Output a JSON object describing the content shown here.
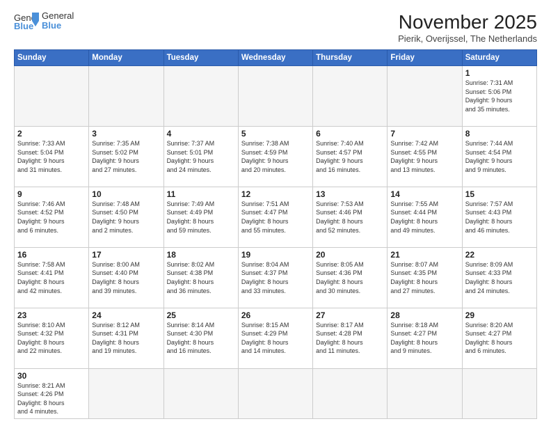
{
  "header": {
    "logo_general": "General",
    "logo_blue": "Blue",
    "title": "November 2025",
    "subtitle": "Pierik, Overijssel, The Netherlands"
  },
  "weekdays": [
    "Sunday",
    "Monday",
    "Tuesday",
    "Wednesday",
    "Thursday",
    "Friday",
    "Saturday"
  ],
  "weeks": [
    [
      {
        "day": "",
        "info": ""
      },
      {
        "day": "",
        "info": ""
      },
      {
        "day": "",
        "info": ""
      },
      {
        "day": "",
        "info": ""
      },
      {
        "day": "",
        "info": ""
      },
      {
        "day": "",
        "info": ""
      },
      {
        "day": "1",
        "info": "Sunrise: 7:31 AM\nSunset: 5:06 PM\nDaylight: 9 hours\nand 35 minutes."
      }
    ],
    [
      {
        "day": "2",
        "info": "Sunrise: 7:33 AM\nSunset: 5:04 PM\nDaylight: 9 hours\nand 31 minutes."
      },
      {
        "day": "3",
        "info": "Sunrise: 7:35 AM\nSunset: 5:02 PM\nDaylight: 9 hours\nand 27 minutes."
      },
      {
        "day": "4",
        "info": "Sunrise: 7:37 AM\nSunset: 5:01 PM\nDaylight: 9 hours\nand 24 minutes."
      },
      {
        "day": "5",
        "info": "Sunrise: 7:38 AM\nSunset: 4:59 PM\nDaylight: 9 hours\nand 20 minutes."
      },
      {
        "day": "6",
        "info": "Sunrise: 7:40 AM\nSunset: 4:57 PM\nDaylight: 9 hours\nand 16 minutes."
      },
      {
        "day": "7",
        "info": "Sunrise: 7:42 AM\nSunset: 4:55 PM\nDaylight: 9 hours\nand 13 minutes."
      },
      {
        "day": "8",
        "info": "Sunrise: 7:44 AM\nSunset: 4:54 PM\nDaylight: 9 hours\nand 9 minutes."
      }
    ],
    [
      {
        "day": "9",
        "info": "Sunrise: 7:46 AM\nSunset: 4:52 PM\nDaylight: 9 hours\nand 6 minutes."
      },
      {
        "day": "10",
        "info": "Sunrise: 7:48 AM\nSunset: 4:50 PM\nDaylight: 9 hours\nand 2 minutes."
      },
      {
        "day": "11",
        "info": "Sunrise: 7:49 AM\nSunset: 4:49 PM\nDaylight: 8 hours\nand 59 minutes."
      },
      {
        "day": "12",
        "info": "Sunrise: 7:51 AM\nSunset: 4:47 PM\nDaylight: 8 hours\nand 55 minutes."
      },
      {
        "day": "13",
        "info": "Sunrise: 7:53 AM\nSunset: 4:46 PM\nDaylight: 8 hours\nand 52 minutes."
      },
      {
        "day": "14",
        "info": "Sunrise: 7:55 AM\nSunset: 4:44 PM\nDaylight: 8 hours\nand 49 minutes."
      },
      {
        "day": "15",
        "info": "Sunrise: 7:57 AM\nSunset: 4:43 PM\nDaylight: 8 hours\nand 46 minutes."
      }
    ],
    [
      {
        "day": "16",
        "info": "Sunrise: 7:58 AM\nSunset: 4:41 PM\nDaylight: 8 hours\nand 42 minutes."
      },
      {
        "day": "17",
        "info": "Sunrise: 8:00 AM\nSunset: 4:40 PM\nDaylight: 8 hours\nand 39 minutes."
      },
      {
        "day": "18",
        "info": "Sunrise: 8:02 AM\nSunset: 4:38 PM\nDaylight: 8 hours\nand 36 minutes."
      },
      {
        "day": "19",
        "info": "Sunrise: 8:04 AM\nSunset: 4:37 PM\nDaylight: 8 hours\nand 33 minutes."
      },
      {
        "day": "20",
        "info": "Sunrise: 8:05 AM\nSunset: 4:36 PM\nDaylight: 8 hours\nand 30 minutes."
      },
      {
        "day": "21",
        "info": "Sunrise: 8:07 AM\nSunset: 4:35 PM\nDaylight: 8 hours\nand 27 minutes."
      },
      {
        "day": "22",
        "info": "Sunrise: 8:09 AM\nSunset: 4:33 PM\nDaylight: 8 hours\nand 24 minutes."
      }
    ],
    [
      {
        "day": "23",
        "info": "Sunrise: 8:10 AM\nSunset: 4:32 PM\nDaylight: 8 hours\nand 22 minutes."
      },
      {
        "day": "24",
        "info": "Sunrise: 8:12 AM\nSunset: 4:31 PM\nDaylight: 8 hours\nand 19 minutes."
      },
      {
        "day": "25",
        "info": "Sunrise: 8:14 AM\nSunset: 4:30 PM\nDaylight: 8 hours\nand 16 minutes."
      },
      {
        "day": "26",
        "info": "Sunrise: 8:15 AM\nSunset: 4:29 PM\nDaylight: 8 hours\nand 14 minutes."
      },
      {
        "day": "27",
        "info": "Sunrise: 8:17 AM\nSunset: 4:28 PM\nDaylight: 8 hours\nand 11 minutes."
      },
      {
        "day": "28",
        "info": "Sunrise: 8:18 AM\nSunset: 4:27 PM\nDaylight: 8 hours\nand 9 minutes."
      },
      {
        "day": "29",
        "info": "Sunrise: 8:20 AM\nSunset: 4:27 PM\nDaylight: 8 hours\nand 6 minutes."
      }
    ],
    [
      {
        "day": "30",
        "info": "Sunrise: 8:21 AM\nSunset: 4:26 PM\nDaylight: 8 hours\nand 4 minutes."
      },
      {
        "day": "",
        "info": ""
      },
      {
        "day": "",
        "info": ""
      },
      {
        "day": "",
        "info": ""
      },
      {
        "day": "",
        "info": ""
      },
      {
        "day": "",
        "info": ""
      },
      {
        "day": "",
        "info": ""
      }
    ]
  ]
}
